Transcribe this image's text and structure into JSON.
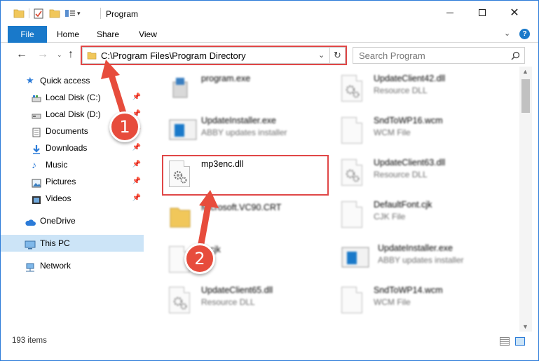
{
  "window": {
    "title": "Program"
  },
  "ribbon": {
    "tabs": [
      "File",
      "Home",
      "Share",
      "View"
    ]
  },
  "address": {
    "path": "C:\\Program Files\\Program Directory"
  },
  "search": {
    "placeholder": "Search Program"
  },
  "sidebar": {
    "quick_access": "Quick access",
    "items": [
      {
        "label": "Local Disk (C:)",
        "icon": "drive-icon",
        "pinned": true
      },
      {
        "label": "Local Disk (D:)",
        "icon": "drive-icon",
        "pinned": true
      },
      {
        "label": "Documents",
        "icon": "documents-icon",
        "pinned": true
      },
      {
        "label": "Downloads",
        "icon": "downloads-icon",
        "pinned": true
      },
      {
        "label": "Music",
        "icon": "music-icon",
        "pinned": true
      },
      {
        "label": "Pictures",
        "icon": "pictures-icon",
        "pinned": true
      },
      {
        "label": "Videos",
        "icon": "videos-icon",
        "pinned": true
      }
    ],
    "onedrive": "OneDrive",
    "this_pc": "This PC",
    "network": "Network"
  },
  "files": {
    "left": [
      {
        "name": "program.exe",
        "desc": "",
        "icon": "exe-icon"
      },
      {
        "name": "UpdateInstaller.exe",
        "desc": "ABBY updates installer",
        "icon": "installer-icon"
      },
      {
        "name": "mp3enc.dll",
        "desc": "",
        "icon": "dll-gear-icon"
      },
      {
        "name": "Microsoft.VC90.CRT",
        "desc": "",
        "icon": "folder-icon"
      },
      {
        "name": "fil.cjk",
        "desc": "file",
        "icon": "file-icon"
      },
      {
        "name": "UpdateClient65.dll",
        "desc": "Resource DLL",
        "icon": "dll-gear-icon"
      }
    ],
    "right": [
      {
        "name": "UpdateClient42.dll",
        "desc": "Resource DLL",
        "icon": "dll-gear-icon"
      },
      {
        "name": "SndToWP16.wcm",
        "desc": "WCM File",
        "icon": "file-icon"
      },
      {
        "name": "UpdateClient63.dll",
        "desc": "Resource DLL",
        "icon": "dll-gear-icon"
      },
      {
        "name": "DefaultFont.cjk",
        "desc": "CJK File",
        "icon": "file-icon"
      },
      {
        "name": "UpdateInstaller.exe",
        "desc": "ABBY updates installer",
        "icon": "installer-icon"
      },
      {
        "name": "SndToWP14.wcm",
        "desc": "WCM File",
        "icon": "file-icon"
      }
    ]
  },
  "status": {
    "item_count": "193 items"
  },
  "annotations": {
    "step1": "1",
    "step2": "2",
    "color": "#e74c3c"
  }
}
